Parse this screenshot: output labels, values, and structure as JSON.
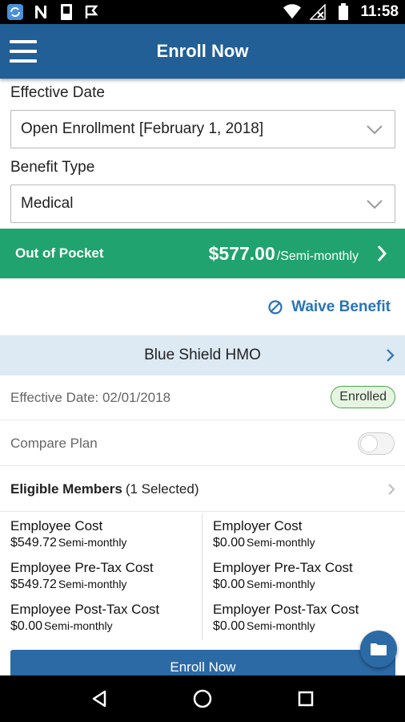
{
  "status_bar": {
    "time": "11:58",
    "left_icons": [
      "sync-icon",
      "n-notification-icon",
      "device-icon",
      "flag-icon"
    ],
    "right_icons": [
      "wifi-icon",
      "no-signal-icon",
      "battery-icon"
    ]
  },
  "app_bar": {
    "title": "Enroll Now",
    "menu_icon": "hamburger-menu-icon"
  },
  "effective_date": {
    "label": "Effective Date",
    "value": "Open Enrollment [February 1, 2018]"
  },
  "benefit_type": {
    "label": "Benefit Type",
    "value": "Medical"
  },
  "out_of_pocket": {
    "label": "Out of Pocket",
    "amount": "$577.00",
    "period": "/Semi-monthly",
    "color": "#20a36e"
  },
  "waive": {
    "label": "Waive Benefit",
    "icon": "block-icon"
  },
  "plan": {
    "name": "Blue Shield HMO",
    "effective_date": "Effective Date: 02/01/2018",
    "status": "Enrolled",
    "compare_label": "Compare Plan",
    "compare_on": false,
    "eligible_label": "Eligible Members",
    "eligible_count": "(1 Selected)"
  },
  "costs": {
    "employee": [
      {
        "label": "Employee Cost",
        "value": "$549.72",
        "period": "Semi-monthly"
      },
      {
        "label": "Employee Pre-Tax Cost",
        "value": "$549.72",
        "period": "Semi-monthly"
      },
      {
        "label": "Employee Post-Tax Cost",
        "value": "$0.00",
        "period": "Semi-monthly"
      }
    ],
    "employer": [
      {
        "label": "Employer Cost",
        "value": "$0.00",
        "period": "Semi-monthly"
      },
      {
        "label": "Employer Pre-Tax Cost",
        "value": "$0.00",
        "period": "Semi-monthly"
      },
      {
        "label": "Employer Post-Tax Cost",
        "value": "$0.00",
        "period": "Semi-monthly"
      }
    ]
  },
  "enroll_button": "Enroll Now",
  "fab_icon": "folder-icon",
  "nav": {
    "back": "back-icon",
    "home": "home-icon",
    "recents": "recents-icon"
  },
  "colors": {
    "primary": "#215f96",
    "accent": "#2874b8",
    "success": "#20a36e"
  }
}
